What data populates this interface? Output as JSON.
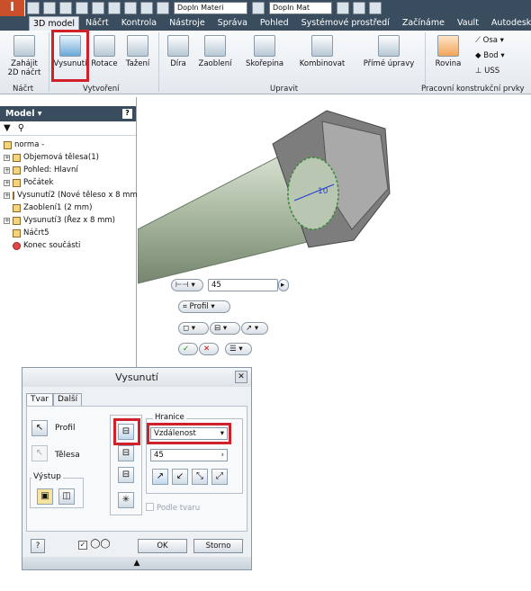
{
  "app": {
    "logo": "I"
  },
  "qat": {
    "material_combo": "DopIn Materi",
    "appearance_combo": "DopIn Mat"
  },
  "tabs": [
    "3D model",
    "Náčrt",
    "Kontrola",
    "Nástroje",
    "Správa",
    "Pohled",
    "Systémové prostředí",
    "Začínáme",
    "Vault",
    "Autodesk 360"
  ],
  "ribbon": {
    "sketch_btn": "Zahájit\n2D náčrt",
    "sketch_arrow": "▾",
    "create_btns": [
      "Vysunutí",
      "Rotace",
      "Tažení"
    ],
    "modify_btns": [
      "Díra",
      "Zaoblení",
      "Skořepina",
      "Kombinovat",
      "Přímé úpravy"
    ],
    "work_btn": "Rovina",
    "work_small": [
      "Osa",
      "Bod",
      "USS"
    ],
    "groups": [
      "Náčrt",
      "Vytvoření",
      "Upravit",
      "Pracovní konstrukční prvky"
    ]
  },
  "panel": {
    "title": "Model",
    "tree": [
      {
        "label": "norma -",
        "exp": ""
      },
      {
        "label": "Objemová tělesa(1)",
        "exp": "+"
      },
      {
        "label": "Pohled: Hlavní",
        "exp": "+"
      },
      {
        "label": "Počátek",
        "exp": "+"
      },
      {
        "label": "Vysunutí2 (Nové těleso x 8 mm",
        "exp": "+"
      },
      {
        "label": "Zaoblení1 (2 mm)",
        "exp": ""
      },
      {
        "label": "Vysunutí3 (Řez x 8 mm)",
        "exp": "+"
      },
      {
        "label": "Náčrt5",
        "exp": ""
      },
      {
        "label": "Konec součásti",
        "exp": ""
      }
    ]
  },
  "viewport": {
    "dimension": "10",
    "distance_value": "45",
    "profile_btn": "Profil"
  },
  "dialog": {
    "title": "Vysunutí",
    "close": "✕",
    "tabs": [
      "Tvar",
      "Další"
    ],
    "profile_label": "Profil",
    "solids_label": "Tělesa",
    "output_label": "Výstup",
    "extents_label": "Hranice",
    "extents_value": "Vzdálenost",
    "distance": "45",
    "match_shape": "Podle tvaru",
    "ok": "OK",
    "cancel": "Storno",
    "help": "?",
    "expand": "▲"
  }
}
